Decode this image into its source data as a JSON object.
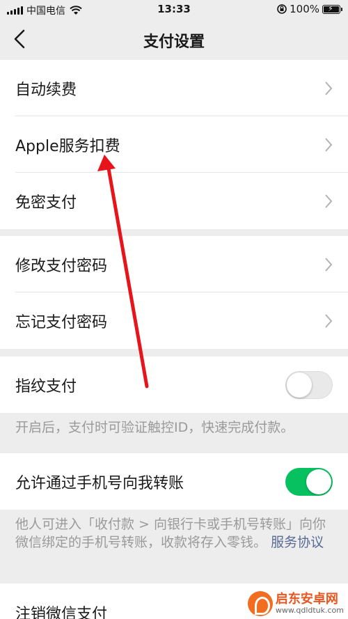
{
  "status_bar": {
    "carrier": "中国电信",
    "time": "13:33",
    "battery": "100%"
  },
  "nav": {
    "title": "支付设置",
    "back_icon": "chevron-left-icon"
  },
  "group1": [
    {
      "label": "自动续费"
    },
    {
      "label": "Apple服务扣费"
    },
    {
      "label": "免密支付"
    }
  ],
  "group2": [
    {
      "label": "修改支付密码"
    },
    {
      "label": "忘记支付密码"
    }
  ],
  "fingerprint": {
    "label": "指纹支付",
    "enabled": false,
    "note": "开启后，支付时可验证触控ID，快速完成付款。"
  },
  "phone_transfer": {
    "label": "允许通过手机号向我转账",
    "enabled": true,
    "note": "他人可进入「收付款 > 向银行卡或手机号转账」向你微信绑定的手机号转账，收款将存入零钱。",
    "link": "服务协议"
  },
  "cancel": {
    "label": "注销微信支付"
  },
  "colors": {
    "accent_green": "#07c160",
    "link_blue": "#576b95",
    "annotation_red": "#e8141c"
  },
  "watermark": {
    "name": "启东安卓网",
    "url": "www.qdldtuk.com"
  }
}
